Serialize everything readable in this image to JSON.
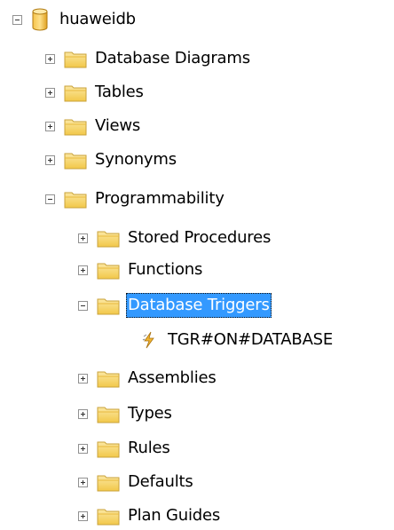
{
  "tree": {
    "root": {
      "label": "huaweidb",
      "icon": "database-icon",
      "state": "expanded"
    },
    "items": [
      {
        "label": "Database Diagrams",
        "icon": "folder-icon",
        "state": "collapsed"
      },
      {
        "label": "Tables",
        "icon": "folder-icon",
        "state": "collapsed"
      },
      {
        "label": "Views",
        "icon": "folder-icon",
        "state": "collapsed"
      },
      {
        "label": "Synonyms",
        "icon": "folder-icon",
        "state": "collapsed"
      },
      {
        "label": "Programmability",
        "icon": "folder-icon",
        "state": "expanded"
      },
      {
        "label": "Stored Procedures",
        "icon": "folder-icon",
        "state": "collapsed"
      },
      {
        "label": "Functions",
        "icon": "folder-icon",
        "state": "collapsed"
      },
      {
        "label": "Database Triggers",
        "icon": "folder-icon",
        "state": "expanded",
        "selected": true
      },
      {
        "label": "TGR#ON#DATABASE",
        "icon": "trigger-icon"
      },
      {
        "label": "Assemblies",
        "icon": "folder-icon",
        "state": "collapsed"
      },
      {
        "label": "Types",
        "icon": "folder-icon",
        "state": "collapsed"
      },
      {
        "label": "Rules",
        "icon": "folder-icon",
        "state": "collapsed"
      },
      {
        "label": "Defaults",
        "icon": "folder-icon",
        "state": "collapsed"
      },
      {
        "label": "Plan Guides",
        "icon": "folder-icon",
        "state": "collapsed"
      }
    ]
  },
  "colors": {
    "selection": "#3399ff",
    "folder": "#f5cf57",
    "database": "#f0b429",
    "trigger": "#e8a317"
  }
}
